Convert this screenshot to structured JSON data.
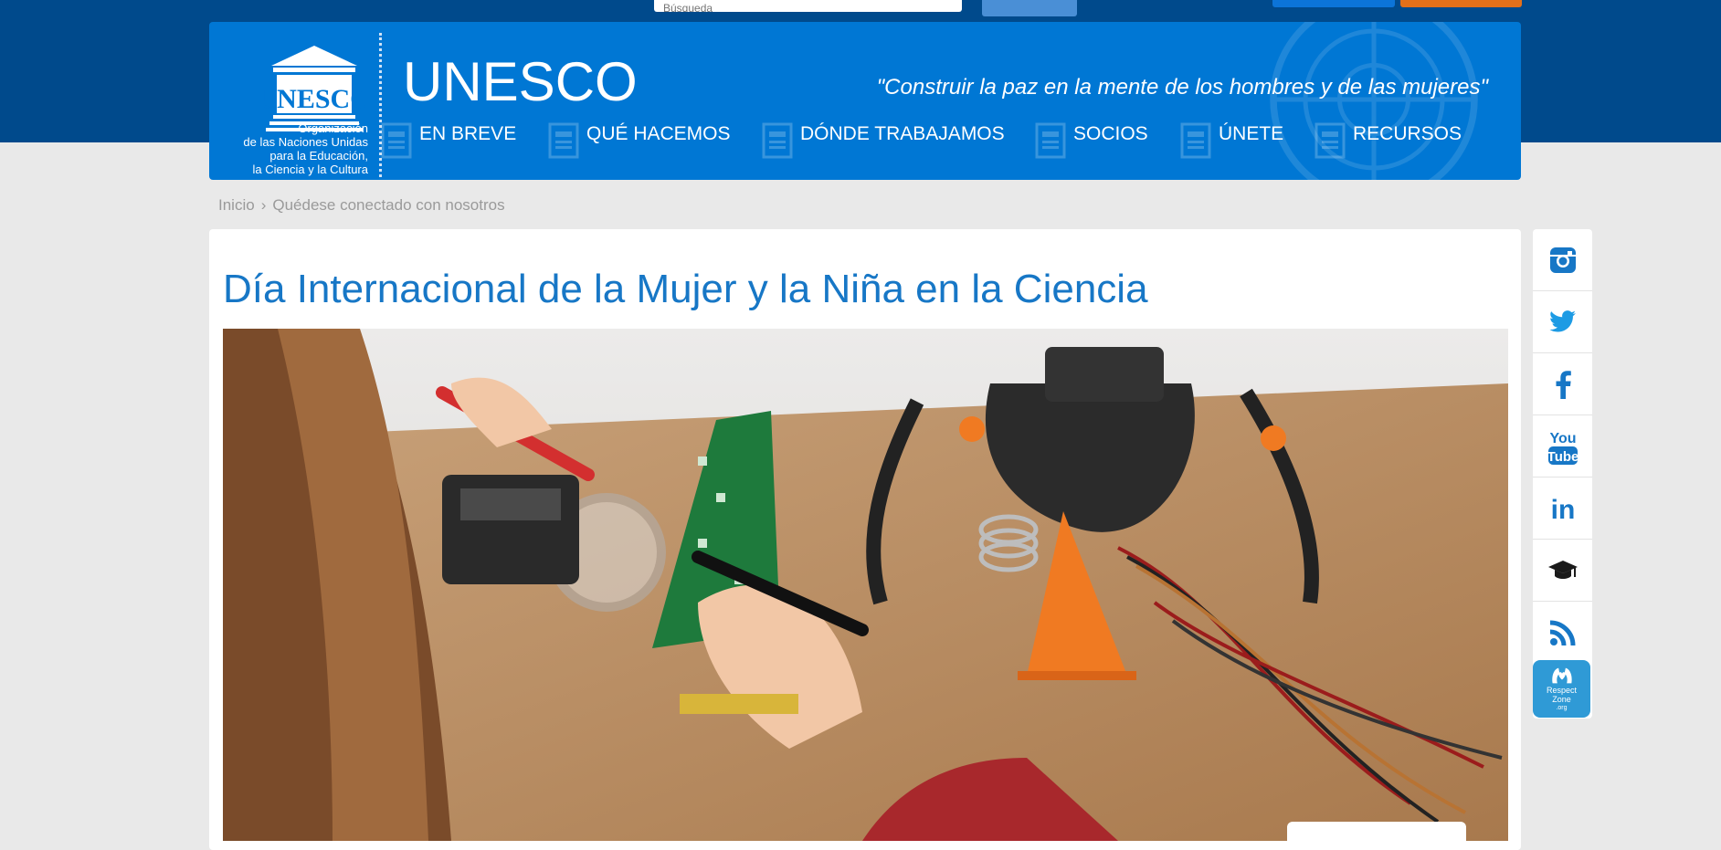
{
  "top": {
    "search_placeholder": "Búsqueda",
    "accent_colors": {
      "search_button": "#4a8fd6",
      "top_button_blue": "#0c74d8",
      "top_button_orange": "#e3701a"
    }
  },
  "header": {
    "logo_icon": "unesco-temple-logo",
    "org_lines": [
      "Organización",
      "de las Naciones Unidas",
      "para la Educación,",
      "la Ciencia y la Cultura"
    ],
    "title": "UNESCO",
    "motto": "\"Construir la paz en la mente de los hombres y de las mujeres\"",
    "nav": [
      {
        "label": "EN BREVE"
      },
      {
        "label": "QUÉ HACEMOS"
      },
      {
        "label": "DÓNDE TRABAJAMOS"
      },
      {
        "label": "SOCIOS"
      },
      {
        "label": "ÚNETE"
      },
      {
        "label": "RECURSOS"
      }
    ],
    "colors": {
      "band": "#004a8c",
      "header": "#0077d4"
    }
  },
  "breadcrumb": {
    "home": "Inicio",
    "separator": "›",
    "current": "Quédese conectado con nosotros"
  },
  "main": {
    "title": "Día Internacional de la Mujer y la Niña en la Ciencia",
    "hero_image": "girl-soldering-circuit-board-with-magnifier-and-robot"
  },
  "social": {
    "icons": [
      "instagram-icon",
      "twitter-icon",
      "facebook-icon",
      "youtube-icon",
      "linkedin-icon",
      "graduation-cap-icon",
      "rss-icon",
      "respect-zone-icon"
    ],
    "youtube_text": [
      "You",
      "Tube"
    ],
    "linkedin_text": "in",
    "respect_zone_lines": [
      "Respect",
      "Zone",
      ".org"
    ],
    "icon_color": "#1777c6"
  }
}
